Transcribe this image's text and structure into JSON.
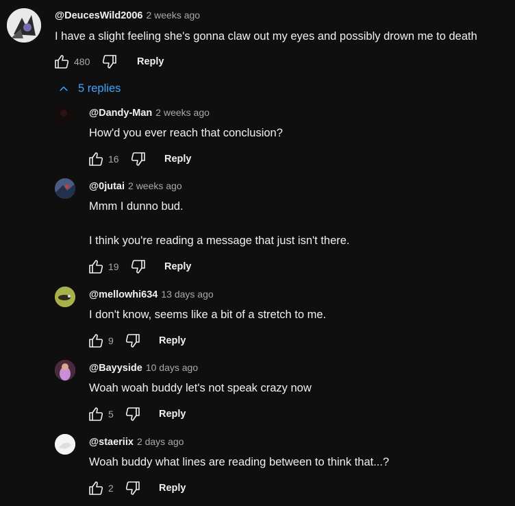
{
  "main_comment": {
    "author": "@DeucesWild2006",
    "time": "2 weeks ago",
    "text": "I have a slight feeling she's gonna claw out my eyes and possibly drown me to death",
    "likes": "480",
    "reply_label": "Reply"
  },
  "replies_toggle": {
    "label": "5 replies"
  },
  "replies": [
    {
      "author": "@Dandy-Man",
      "time": "2 weeks ago",
      "lines": [
        "How'd you ever reach that conclusion?"
      ],
      "likes": "16",
      "reply_label": "Reply"
    },
    {
      "author": "@0jutai",
      "time": "2 weeks ago",
      "lines": [
        "Mmm I dunno bud.",
        "I think you're reading a message that just isn't there."
      ],
      "likes": "19",
      "reply_label": "Reply"
    },
    {
      "author": "@mellowhi634",
      "time": "13 days ago",
      "lines": [
        "I don't know, seems like a bit of a stretch to me."
      ],
      "likes": "9",
      "reply_label": "Reply"
    },
    {
      "author": "@Bayyside",
      "time": "10 days ago",
      "lines": [
        "Woah woah buddy let's not speak crazy now"
      ],
      "likes": "5",
      "reply_label": "Reply"
    },
    {
      "author": "@staeriix",
      "time": "2 days ago",
      "lines": [
        "Woah buddy what lines are reading between to think that...?"
      ],
      "likes": "2",
      "reply_label": "Reply"
    }
  ],
  "icons": {
    "like": "thumb-up-icon",
    "dislike": "thumb-down-icon",
    "toggle": "chevron-up-icon"
  },
  "colors": {
    "background": "#0f0f0f",
    "text": "#f1f1f1",
    "secondary": "#aaaaaa",
    "link": "#3ea6ff"
  }
}
